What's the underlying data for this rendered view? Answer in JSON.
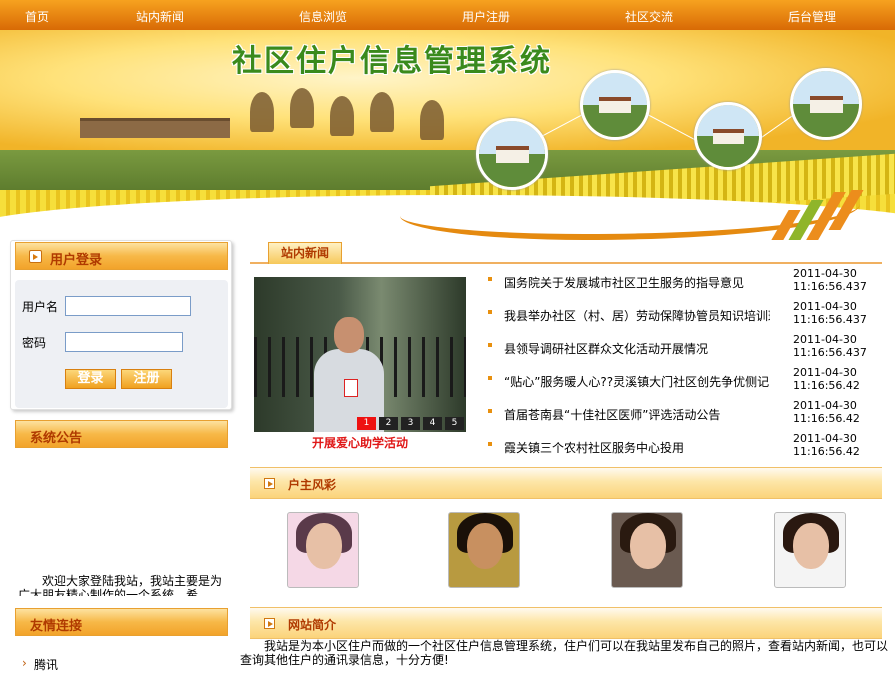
{
  "nav": {
    "items": [
      "首页",
      "站内新闻",
      "信息浏览",
      "用户注册",
      "社区交流",
      "后台管理"
    ]
  },
  "banner": {
    "title": "社区住户信息管理系统"
  },
  "login": {
    "heading": "用户登录",
    "username_label": "用户名",
    "password_label": "密码",
    "username_value": "",
    "password_value": "",
    "login_button": "登录",
    "register_button": "注册"
  },
  "notice": {
    "heading": "系统公告",
    "text": "欢迎大家登陆我站，我站主要是为广大朋友精心制作的一个系统，希"
  },
  "links": {
    "heading": "友情连接",
    "items": [
      "腾讯"
    ]
  },
  "news": {
    "tab": "站内新闻",
    "slideshow": {
      "caption": "开展爱心助学活动",
      "pages": [
        "1",
        "2",
        "3",
        "4",
        "5"
      ],
      "active_page": "1"
    },
    "items": [
      {
        "title": "国务院关于发展城市社区卫生服务的指导意见",
        "date": "2011-04-30",
        "time": "11:16:56.437"
      },
      {
        "title": "我县举办社区（村、居）劳动保障协管员知识培训班",
        "date": "2011-04-30",
        "time": "11:16:56.437"
      },
      {
        "title": "县领导调研社区群众文化活动开展情况",
        "date": "2011-04-30",
        "time": "11:16:56.437"
      },
      {
        "title": "“贴心”服务暖人心??灵溪镇大门社区创先争优侧记",
        "date": "2011-04-30",
        "time": "11:16:56.42"
      },
      {
        "title": "首届苍南县“十佳社区医师”评选活动公告",
        "date": "2011-04-30",
        "time": "11:16:56.42"
      },
      {
        "title": "霞关镇三个农村社区服务中心投用",
        "date": "2011-04-30",
        "time": "11:16:56.42"
      }
    ]
  },
  "residents": {
    "heading": "户主风彩",
    "photo_count_shown": 4
  },
  "about": {
    "heading": "网站简介",
    "text": "我站是为本小区住户而做的一个社区住户信息管理系统，住户们可以在我站里发布自己的照片，查看站内新闻，也可以查询其他住户的通讯录信息，十分方便!"
  },
  "colors": {
    "nav_orange": "#e8820e",
    "section_text": "#b03a00",
    "caption_red": "#e01818",
    "title_green": "#3a8a1c"
  }
}
